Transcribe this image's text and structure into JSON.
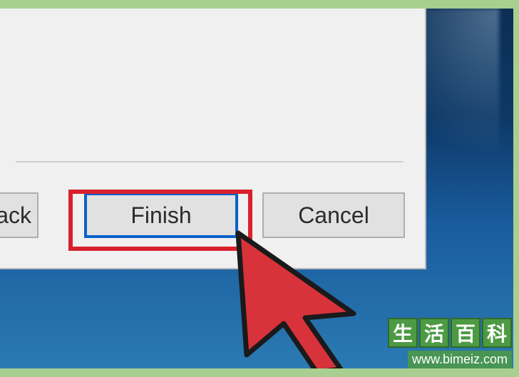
{
  "dialog": {
    "buttons": {
      "back_label_fragment": "ack",
      "finish_label": "Finish",
      "cancel_label": "Cancel"
    }
  },
  "watermark": {
    "chars": [
      "生",
      "活",
      "百",
      "科"
    ],
    "url": "www.bimeiz.com"
  }
}
